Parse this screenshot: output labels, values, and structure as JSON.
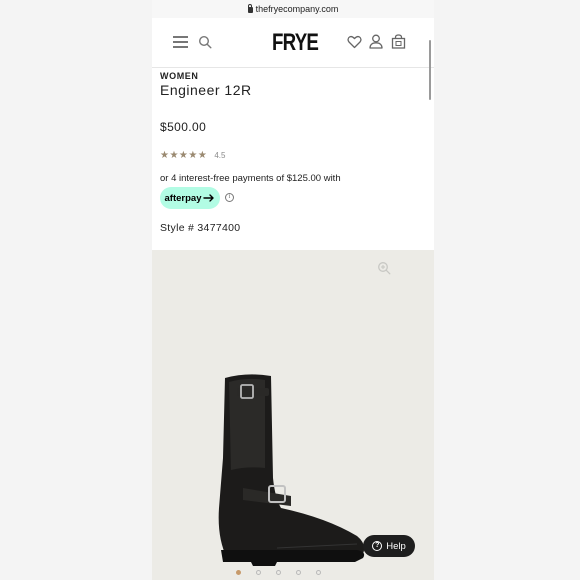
{
  "browser": {
    "url": "thefryecompany.com"
  },
  "header": {
    "logo": "FRYE",
    "icons": [
      "menu-icon",
      "search-icon",
      "heart-icon",
      "user-icon",
      "bag-icon"
    ]
  },
  "product": {
    "category": "WOMEN",
    "name": "Engineer 12R",
    "price": "$500.00",
    "rating_stars": "★★★★★",
    "rating_value": "4.5",
    "installments_text": "or 4 interest-free payments of $125.00 with",
    "afterpay_label": "afterpay",
    "style_number": "Style # 3477400"
  },
  "gallery": {
    "help_label": "Help",
    "dot_count": 5,
    "active_dot": 0
  },
  "colors": {
    "afterpay": "#b2fce4",
    "accent_dot": "#c79a6b",
    "star": "#9a8970"
  }
}
